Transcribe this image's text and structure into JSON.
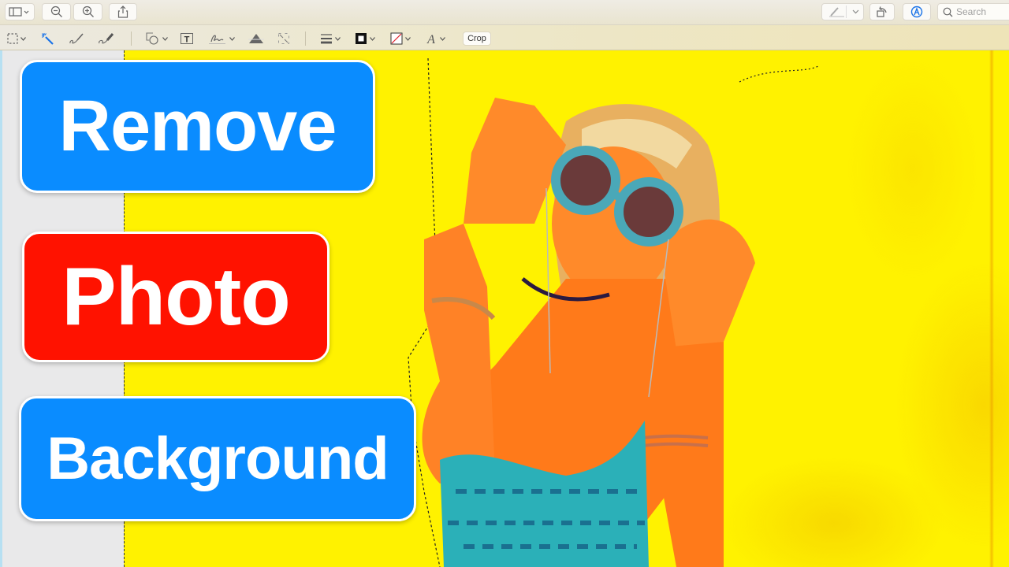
{
  "toolbar": {
    "left_buttons": [
      {
        "name": "sidebar-toggle",
        "icon": "sidebar-icon",
        "has_dropdown": true
      },
      {
        "name": "zoom-out",
        "icon": "zoom-out-icon"
      },
      {
        "name": "zoom-in",
        "icon": "zoom-in-icon"
      },
      {
        "name": "share",
        "icon": "share-icon"
      }
    ],
    "right_buttons": [
      {
        "name": "highlight",
        "icon": "highlighter-icon",
        "has_dropdown": true
      },
      {
        "name": "rotate",
        "icon": "rotate-icon"
      },
      {
        "name": "markup",
        "icon": "markup-icon",
        "active": true
      }
    ],
    "search": {
      "placeholder": "Search",
      "value": ""
    }
  },
  "markup_toolbar": {
    "tools": [
      {
        "name": "rectangular-selection",
        "icon": "selection-icon",
        "has_dropdown": true
      },
      {
        "name": "instant-alpha",
        "icon": "magic-wand-icon",
        "active": true
      },
      {
        "name": "sketch",
        "icon": "sketch-icon"
      },
      {
        "name": "draw",
        "icon": "draw-icon"
      },
      {
        "name": "shapes",
        "icon": "shapes-icon",
        "has_dropdown": true
      },
      {
        "name": "text",
        "icon": "text-box-icon"
      },
      {
        "name": "sign",
        "icon": "signature-icon",
        "has_dropdown": true
      },
      {
        "name": "adjust-color",
        "icon": "adjust-color-icon"
      },
      {
        "name": "adjust-size",
        "icon": "resize-icon"
      },
      {
        "name": "shape-style",
        "icon": "line-style-icon",
        "has_dropdown": true
      },
      {
        "name": "border-color",
        "icon": "border-color-icon",
        "has_dropdown": true
      },
      {
        "name": "fill-color",
        "icon": "fill-color-icon",
        "has_dropdown": true
      },
      {
        "name": "text-style",
        "icon": "font-icon",
        "has_dropdown": true
      }
    ],
    "crop_label": "Crop"
  },
  "overlay": {
    "line1": "Remove",
    "line2": "Photo",
    "line3": "Background"
  },
  "colors": {
    "accent_blue": "#0a8cff",
    "accent_red": "#ff1200",
    "canvas_yellow": "#fff200",
    "markup_active": "#1a73e8"
  }
}
